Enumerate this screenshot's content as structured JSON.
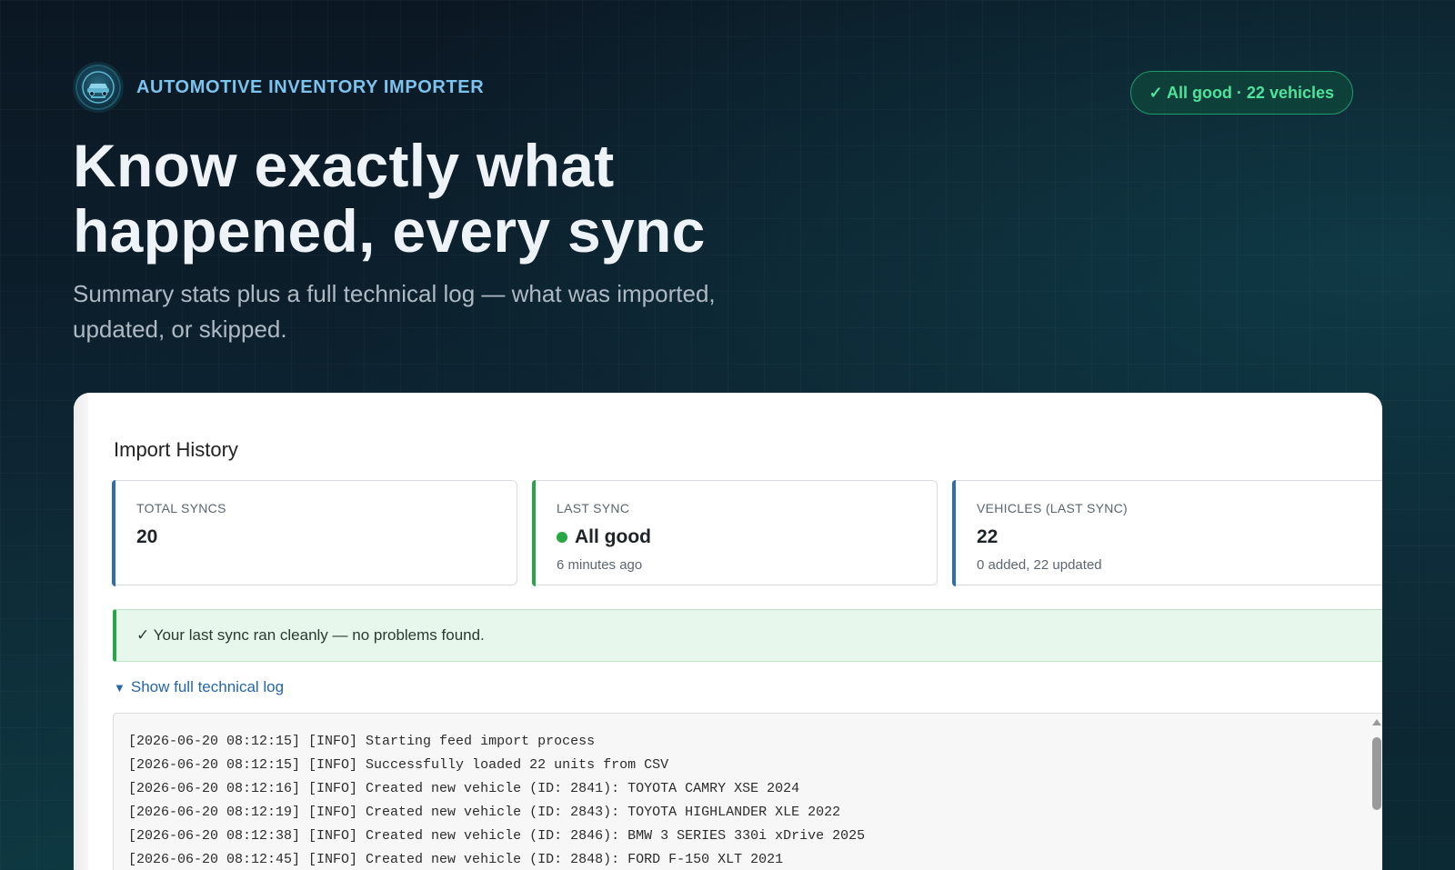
{
  "header": {
    "app_name": "AUTOMOTIVE INVENTORY IMPORTER",
    "logo_icon": "car-badge-logo",
    "status_pill": "✓ All good · 22 vehicles"
  },
  "hero": {
    "title": "Know exactly what happened, every sync",
    "subtitle": "Summary stats plus a full technical log — what was imported, updated, or skipped."
  },
  "import_history": {
    "title": "Import History",
    "stats": {
      "total_syncs": {
        "label": "TOTAL SYNCS",
        "value": "20"
      },
      "last_sync": {
        "label": "LAST SYNC",
        "value": "All good",
        "sub": "6 minutes ago"
      },
      "vehicles": {
        "label": "VEHICLES (LAST SYNC)",
        "value": "22",
        "sub": "0 added, 22 updated"
      }
    },
    "banner": "✓ Your last sync ran cleanly — no problems found.",
    "toggle_label": "Show full technical log",
    "log_lines": [
      "[2026-06-20 08:12:15] [INFO] Starting feed import process",
      "[2026-06-20 08:12:15] [INFO] Successfully loaded 22 units from CSV",
      "[2026-06-20 08:12:16] [INFO] Created new vehicle (ID: 2841): TOYOTA CAMRY XSE 2024",
      "[2026-06-20 08:12:19] [INFO] Created new vehicle (ID: 2843): TOYOTA HIGHLANDER XLE 2022",
      "[2026-06-20 08:12:38] [INFO] Created new vehicle (ID: 2846): BMW 3 SERIES 330i xDrive 2025",
      "[2026-06-20 08:12:45] [INFO] Created new vehicle (ID: 2848): FORD F-150 XLT 2021"
    ]
  },
  "colors": {
    "accent_blue": "#2b6fae",
    "success_green": "#2aa44a",
    "pill_green": "#4ee39a",
    "brand_text": "#7cc3ee"
  }
}
